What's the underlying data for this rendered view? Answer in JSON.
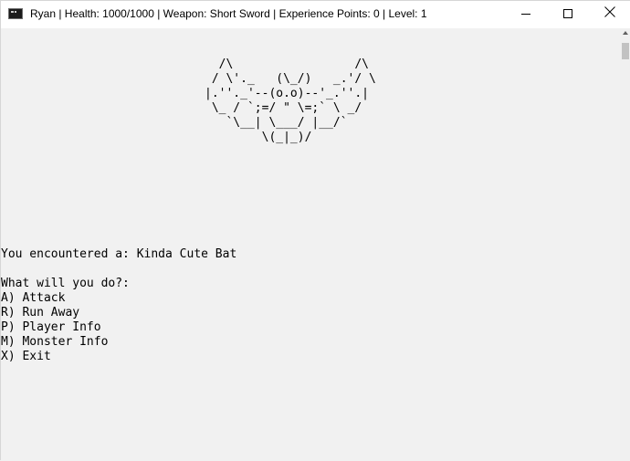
{
  "window": {
    "title": "Ryan | Health: 1000/1000 | Weapon: Short Sword | Experience Points: 0 | Level: 1",
    "icon": "console-icon"
  },
  "console": {
    "ascii_art": "  /\\                 /\\\n / \\'._   (\\_/)   _.'/ \\\n|.''._'--(o.o)--'_.''.|\n \\_ / `;=/ \" \\=;` \\ _/\n   `\\__| \\___/ |__/`\n        \\(_|_)/",
    "encounter_text": "You encountered a: Kinda Cute Bat",
    "prompt": "What will you do?:",
    "options": [
      "A) Attack",
      "R) Run Away",
      "P) Player Info",
      "M) Monster Info",
      "X) Exit"
    ]
  },
  "colors": {
    "titlebar_bg": "#ffffff",
    "console_bg": "#f1f1f1",
    "text": "#000000"
  }
}
